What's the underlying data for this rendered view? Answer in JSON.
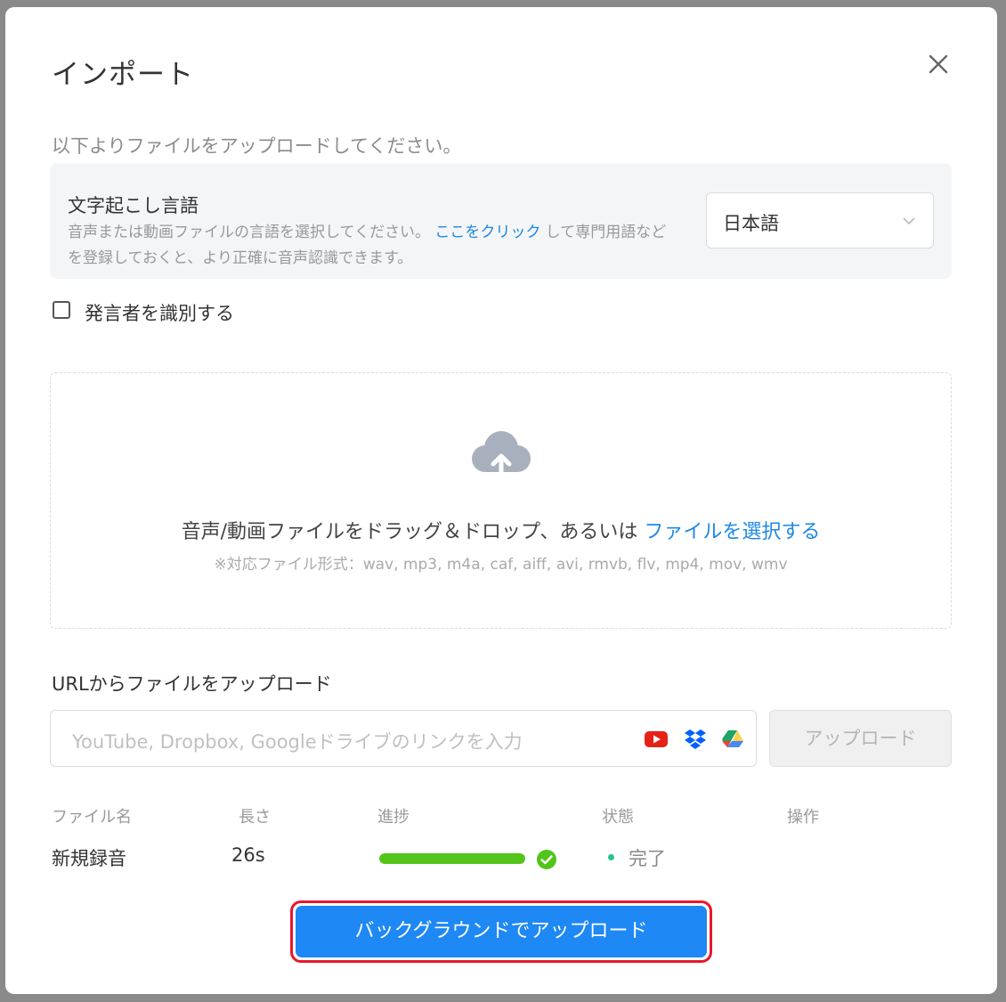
{
  "dialog": {
    "title": "インポート",
    "subtitle": "以下よりファイルをアップロードしてください。"
  },
  "language": {
    "title": "文字起こし言語",
    "desc_before": "音声または動画ファイルの言語を選択してください。",
    "desc_link": "ここをクリック",
    "desc_after": "して専門用語などを登録しておくと、より正確に音声認識できます。",
    "selected": "日本語"
  },
  "speaker": {
    "label": "発言者を識別する",
    "checked": false
  },
  "dropzone": {
    "text": "音声/動画ファイルをドラッグ＆ドロップ、あるいは",
    "link": "ファイルを選択する",
    "formats": "※対応ファイル形式：wav, mp3, m4a, caf, aiff, avi, rmvb, flv, mp4, mov, wmv"
  },
  "url": {
    "label": "URLからファイルをアップロード",
    "placeholder": "YouTube, Dropbox, Googleドライブのリンクを入力",
    "upload_label": "アップロード"
  },
  "table": {
    "headers": [
      "ファイル名",
      "長さ",
      "進捗",
      "状態",
      "操作"
    ],
    "rows": [
      {
        "name": "新規録音",
        "length": "26s",
        "progress": 1.0,
        "status": "完了"
      }
    ]
  },
  "footer": {
    "background_upload_label": "バックグラウンドでアップロード"
  },
  "colors": {
    "accent": "#1e88f5",
    "link": "#1e88e5",
    "progress": "#52c41a",
    "status_done": "#27c28a",
    "highlight": "#e8172c"
  },
  "icons": {
    "close": "close-icon",
    "chevron": "chevron-down-icon",
    "upload": "cloud-upload-icon",
    "youtube": "youtube-icon",
    "dropbox": "dropbox-icon",
    "google_drive": "google-drive-icon",
    "check": "check-circle-icon"
  }
}
